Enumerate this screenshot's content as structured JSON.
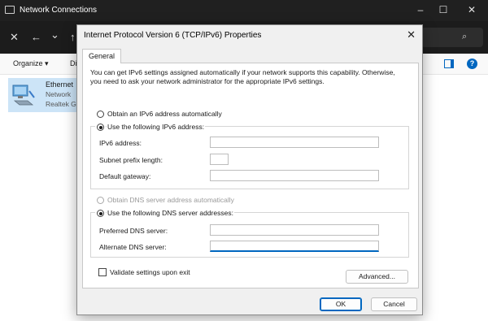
{
  "explorer": {
    "title": "Network Connections",
    "window_controls": {
      "minimize": "–",
      "maximize": "☐",
      "close": "✕"
    },
    "nav": {
      "close": "✕",
      "back": "←",
      "forward": "→",
      "recent": "⌄",
      "up": "↑"
    },
    "command_bar": {
      "organize": "Organize",
      "organize_arrow": "▾",
      "partial": "Di"
    },
    "help_glyph": "?",
    "adapter": {
      "name": "Ethernet",
      "status": "Network",
      "device": "Realtek G"
    }
  },
  "dialog": {
    "title": "Internet Protocol Version 6 (TCP/IPv6) Properties",
    "close": "✕",
    "tab": "General",
    "description": "You can get IPv6 settings assigned automatically if your network supports this capability. Otherwise, you need to ask your network administrator for the appropriate IPv6 settings.",
    "ip_mode": {
      "auto_label": "Obtain an IPv6 address automatically",
      "manual_label": "Use the following IPv6 address:",
      "selected": "manual"
    },
    "ip_fields": {
      "ipv6_address": {
        "label": "IPv6 address:",
        "value": ""
      },
      "subnet_prefix": {
        "label": "Subnet prefix length:",
        "value": ""
      },
      "default_gateway": {
        "label": "Default gateway:",
        "value": ""
      }
    },
    "dns_mode": {
      "auto_label": "Obtain DNS server address automatically",
      "manual_label": "Use the following DNS server addresses:",
      "selected": "manual",
      "auto_disabled": true
    },
    "dns_fields": {
      "preferred": {
        "label": "Preferred DNS server:",
        "value": ""
      },
      "alternate": {
        "label": "Alternate DNS server:",
        "value": ""
      }
    },
    "validate_label": "Validate settings upon exit",
    "validate_checked": false,
    "advanced_label": "Advanced...",
    "ok_label": "OK",
    "cancel_label": "Cancel"
  },
  "colors": {
    "accent": "#0067c0",
    "title_bar": "#202020",
    "dialog_bg": "#f0f0f0",
    "selection": "#cce4f7"
  }
}
